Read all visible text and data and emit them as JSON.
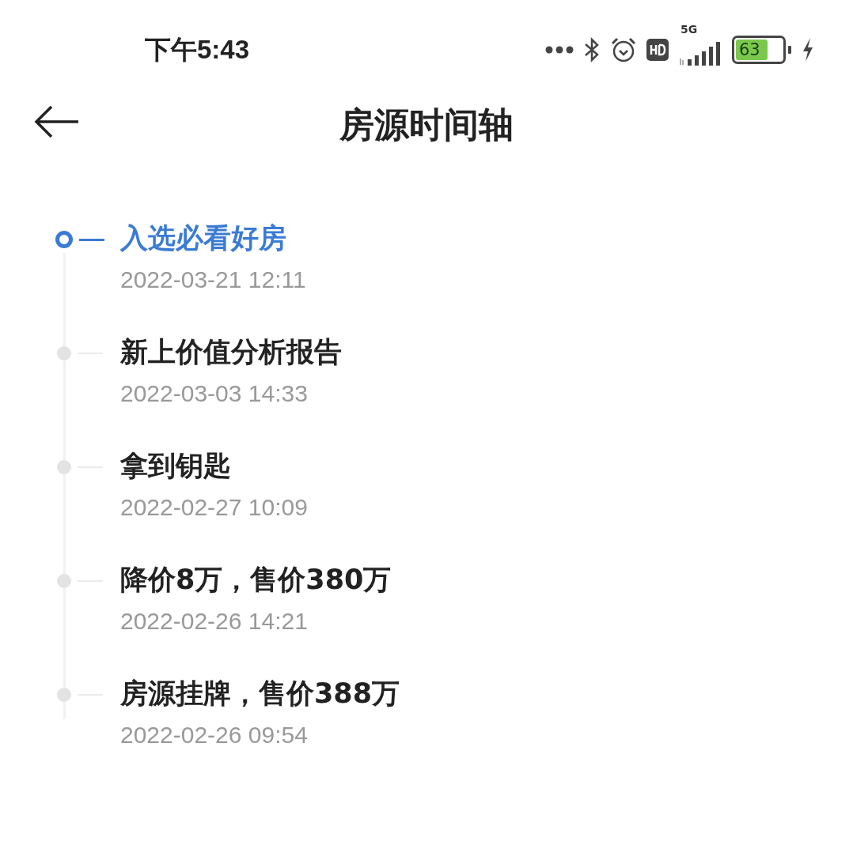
{
  "status_bar": {
    "time": "下午5:43",
    "network": "5G",
    "battery": "63"
  },
  "header": {
    "title": "房源时间轴"
  },
  "timeline": [
    {
      "title": "入选必看好房",
      "time": "2022-03-21 12:11",
      "active": true
    },
    {
      "title": "新上价值分析报告",
      "time": "2022-03-03 14:33",
      "active": false
    },
    {
      "title": "拿到钥匙",
      "time": "2022-02-27 10:09",
      "active": false
    },
    {
      "title": "降价8万，售价380万",
      "time": "2022-02-26 14:21",
      "active": false
    },
    {
      "title": "房源挂牌，售价388万",
      "time": "2022-02-26 09:54",
      "active": false
    }
  ]
}
